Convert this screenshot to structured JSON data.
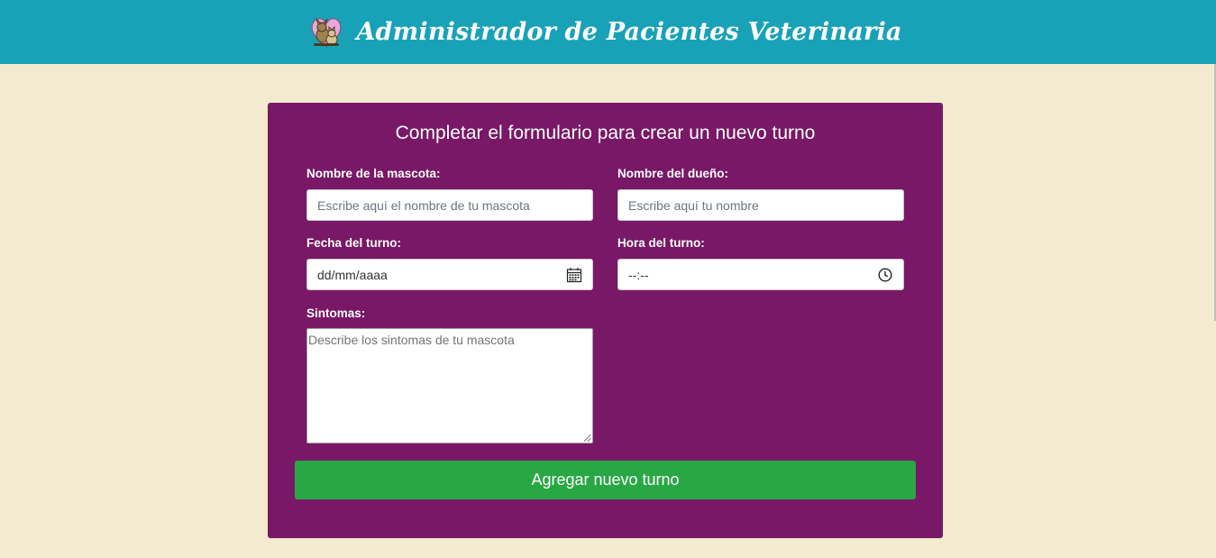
{
  "header": {
    "title": "Administrador de Pacientes Veterinaria",
    "logo_icon": "pets-heart-icon"
  },
  "form": {
    "title": "Completar el formulario para crear un nuevo turno",
    "pet_name": {
      "label": "Nombre de la mascota:",
      "placeholder": "Escribe aquí el nombre de tu mascota",
      "value": ""
    },
    "owner_name": {
      "label": "Nombre del dueño:",
      "placeholder": "Escribe aquí tu nombre",
      "value": ""
    },
    "date": {
      "label": "Fecha del turno:",
      "placeholder": "dd/mm/aaaa",
      "icon": "calendar-icon"
    },
    "time": {
      "label": "Hora del turno:",
      "placeholder": "--:--",
      "icon": "clock-icon"
    },
    "symptoms": {
      "label": "Sintomas:",
      "placeholder": "Describe los sintomas de tu mascota",
      "value": ""
    },
    "submit_label": "Agregar nuevo turno"
  },
  "colors": {
    "header_bg": "#18a2b8",
    "page_bg": "#f3ead0",
    "panel_bg": "#791866",
    "button_bg": "#28a745"
  }
}
